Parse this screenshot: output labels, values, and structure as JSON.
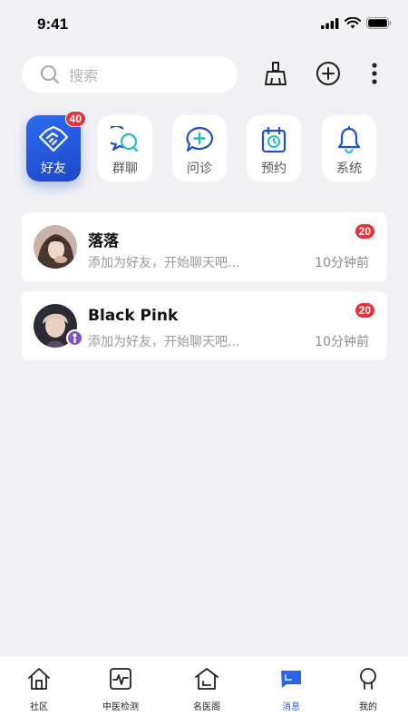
{
  "status_bar": {
    "time": "9:41"
  },
  "search": {
    "placeholder": "搜索"
  },
  "header_actions": [
    {
      "icon": "broom-icon"
    },
    {
      "icon": "plus-circle-icon"
    },
    {
      "icon": "more-vertical-icon"
    }
  ],
  "quick_tiles": [
    {
      "label": "好友",
      "icon": "handshake-icon",
      "badge": "40",
      "active": true
    },
    {
      "label": "群聊",
      "icon": "group-chat-icon"
    },
    {
      "label": "问诊",
      "icon": "consult-icon"
    },
    {
      "label": "预约",
      "icon": "appointment-icon"
    },
    {
      "label": "系统",
      "icon": "bell-icon"
    }
  ],
  "chats": [
    {
      "name": "落落",
      "preview": "添加为好友，开始聊天吧...",
      "time": "10分钟前",
      "badge": "20"
    },
    {
      "name": "Black Pink",
      "preview": "添加为好友，开始聊天吧...",
      "time": "10分钟前",
      "badge": "20"
    }
  ],
  "tabbar": [
    {
      "label": "社区",
      "icon": "home-icon"
    },
    {
      "label": "中医检测",
      "icon": "pulse-icon"
    },
    {
      "label": "名医阁",
      "icon": "pavilion-icon"
    },
    {
      "label": "消息",
      "icon": "message-icon",
      "active": true
    },
    {
      "label": "我的",
      "icon": "profile-icon"
    }
  ],
  "colors": {
    "accent": "#2a63e8",
    "badge": "#e8313b",
    "background": "#f2f2f4"
  }
}
